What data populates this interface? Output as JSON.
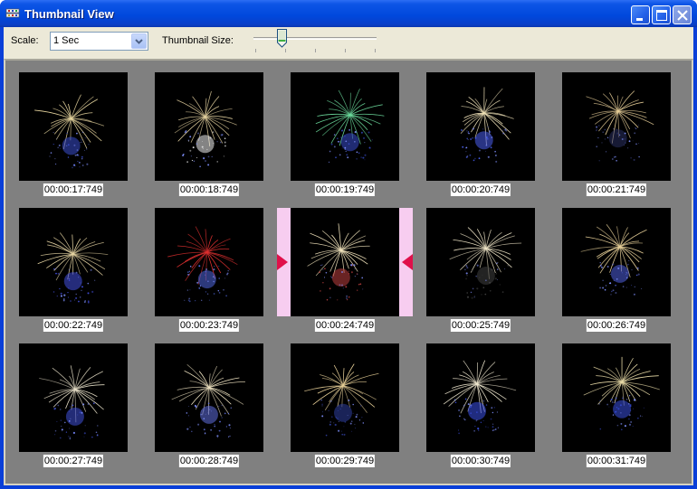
{
  "window": {
    "title": "Thumbnail View",
    "icon": "film-app-icon",
    "buttons": [
      "minimize",
      "maximize",
      "close"
    ]
  },
  "toolbar": {
    "scale_label": "Scale:",
    "scale_value": "1 Sec",
    "thumbnail_size_label": "Thumbnail Size:",
    "thumbnail_size_level": 0.25
  },
  "thumbnails": [
    {
      "time": "00:00:17:749",
      "burst": "#e9d7a0",
      "core": "#3a4fd0",
      "selected": false
    },
    {
      "time": "00:00:18:749",
      "burst": "#e6d3a0",
      "core": "#f0f0f0",
      "selected": false
    },
    {
      "time": "00:00:19:749",
      "burst": "#6ee0a0",
      "core": "#3a4fd0",
      "selected": false
    },
    {
      "time": "00:00:20:749",
      "burst": "#f0e2b8",
      "core": "#4a5ff0",
      "selected": false
    },
    {
      "time": "00:00:21:749",
      "burst": "#e8cf98",
      "core": "#2a3060",
      "selected": false
    },
    {
      "time": "00:00:22:749",
      "burst": "#e8d6a4",
      "core": "#4450e0",
      "selected": false
    },
    {
      "time": "00:00:23:749",
      "burst": "#e03030",
      "core": "#5068e0",
      "selected": false
    },
    {
      "time": "00:00:24:749",
      "burst": "#f2e4bc",
      "core": "#c04040",
      "selected": true
    },
    {
      "time": "00:00:25:749",
      "burst": "#f0e6c8",
      "core": "#404040",
      "selected": false
    },
    {
      "time": "00:00:26:749",
      "burst": "#e6cf98",
      "core": "#5060e0",
      "selected": false
    },
    {
      "time": "00:00:27:749",
      "burst": "#e8e0c8",
      "core": "#4050d8",
      "selected": false
    },
    {
      "time": "00:00:28:749",
      "burst": "#eee2c0",
      "core": "#6070e0",
      "selected": false
    },
    {
      "time": "00:00:29:749",
      "burst": "#e8d098",
      "core": "#3040a0",
      "selected": false
    },
    {
      "time": "00:00:30:749",
      "burst": "#f0e8d0",
      "core": "#3a50e8",
      "selected": false
    },
    {
      "time": "00:00:31:749",
      "burst": "#eadca8",
      "core": "#3a50e0",
      "selected": false
    }
  ],
  "colors": {
    "titlebar": "#0048dc",
    "client": "#ece9d8",
    "view_background": "#808080",
    "selection_bar": "#f7cdf0",
    "selection_arrow": "#e0104a"
  }
}
